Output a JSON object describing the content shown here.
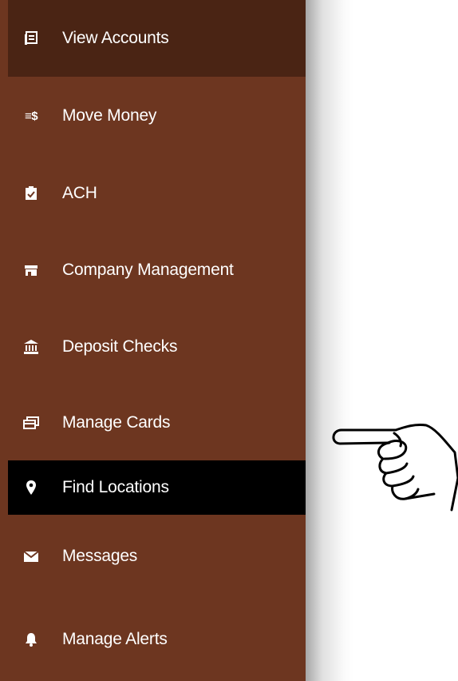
{
  "menu": {
    "items": [
      {
        "label": "View Accounts",
        "icon": "accounts-icon"
      },
      {
        "label": "Move Money",
        "icon": "transfer-dollar-icon",
        "icon_text": "≡$"
      },
      {
        "label": "ACH",
        "icon": "clipboard-check-icon"
      },
      {
        "label": "Company Management",
        "icon": "store-icon"
      },
      {
        "label": "Deposit Checks",
        "icon": "bank-icon"
      },
      {
        "label": "Manage Cards",
        "icon": "credit-cards-icon"
      },
      {
        "label": "Find Locations",
        "icon": "location-pin-icon"
      },
      {
        "label": "Messages",
        "icon": "envelope-icon"
      },
      {
        "label": "Manage Alerts",
        "icon": "bell-icon"
      }
    ],
    "highlighted_index": 6
  },
  "colors": {
    "menu_bg": "#6d3620",
    "top_item_bg": "#4a2414",
    "highlight_bg": "#000000",
    "text": "#ffffff"
  }
}
